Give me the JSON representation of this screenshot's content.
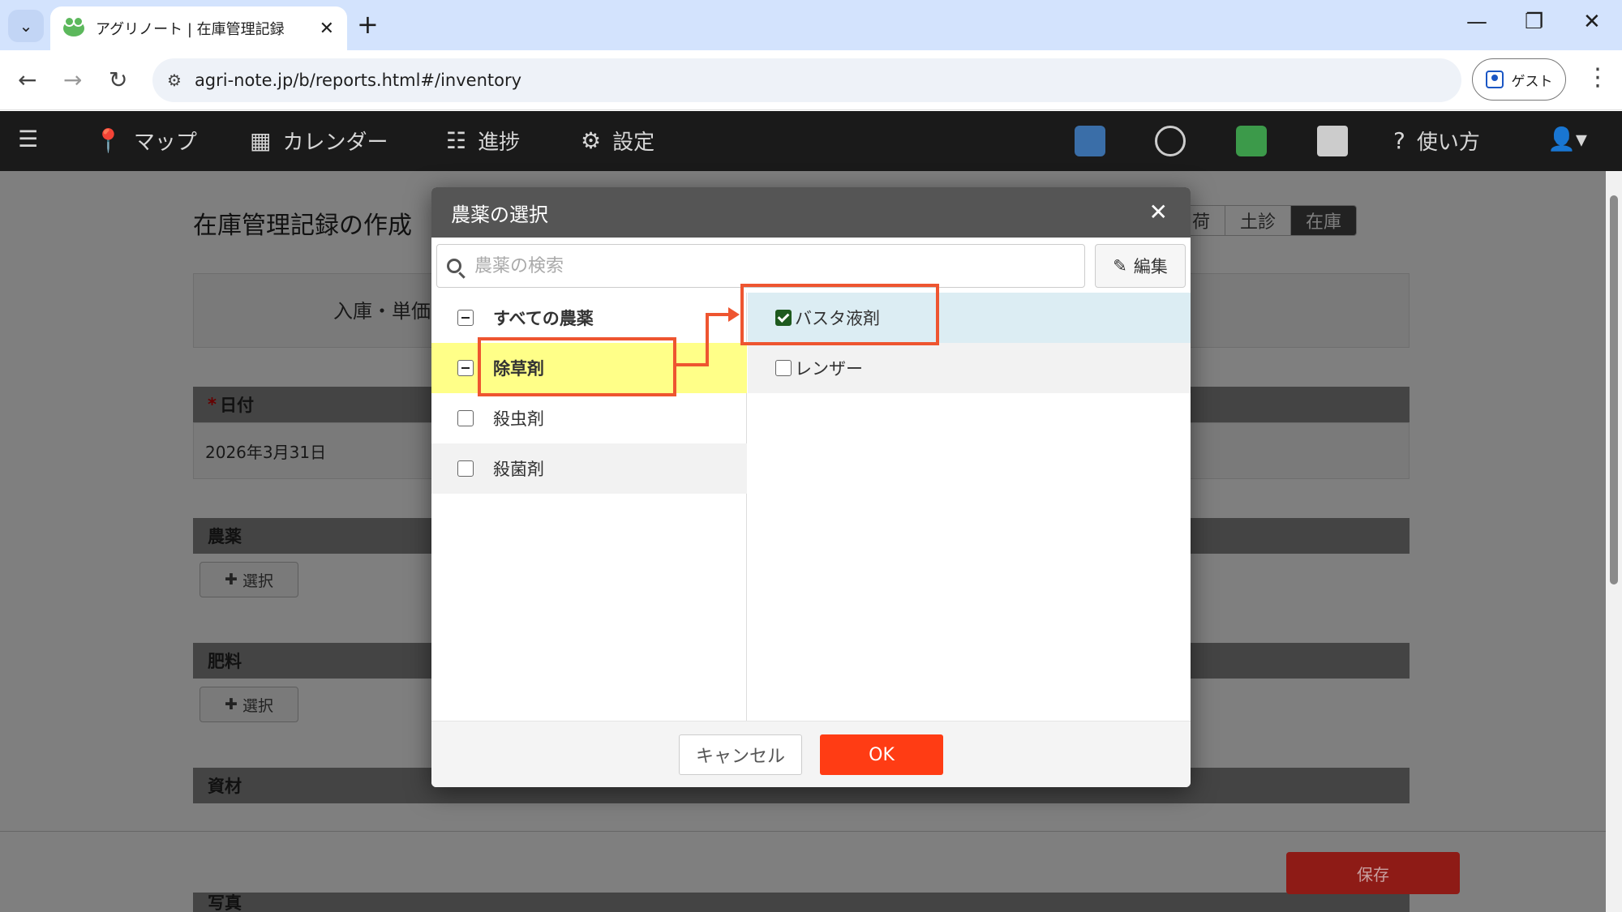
{
  "browser": {
    "tab_title": "アグリノート | 在庫管理記録",
    "url": "agri-note.jp/b/reports.html#/inventory",
    "profile_label": "ゲスト"
  },
  "app_nav": {
    "items": [
      {
        "label": "マップ",
        "icon": "map-pin-icon"
      },
      {
        "label": "カレンダー",
        "icon": "calendar-icon"
      },
      {
        "label": "進捗",
        "icon": "list-icon"
      },
      {
        "label": "設定",
        "icon": "gear-icon"
      }
    ],
    "help_label": "使い方"
  },
  "page": {
    "title": "在庫管理記録の作成",
    "tabs": [
      "荷",
      "土診",
      "在庫"
    ],
    "action_label": "入庫・単価",
    "date_label": "日付",
    "date_value": "2026年3月31日",
    "sections": [
      "農薬",
      "肥料",
      "資材",
      "写真"
    ],
    "select_label": "選択",
    "save_label": "保存"
  },
  "modal": {
    "title": "農薬の選択",
    "search_placeholder": "農薬の検索",
    "edit_label": "編集",
    "categories": [
      {
        "label": "すべての農薬",
        "state": "partial"
      },
      {
        "label": "除草剤",
        "state": "partial"
      },
      {
        "label": "殺虫剤",
        "state": "unchecked"
      },
      {
        "label": "殺菌剤",
        "state": "unchecked"
      }
    ],
    "items": [
      {
        "label": "バスタ液剤",
        "checked": true
      },
      {
        "label": "レンザー",
        "checked": false
      }
    ],
    "cancel_label": "キャンセル",
    "ok_label": "OK"
  },
  "colors": {
    "ok_button": "#ff3c14",
    "highlight_row": "#ffff88",
    "annotation": "#ee5530"
  }
}
